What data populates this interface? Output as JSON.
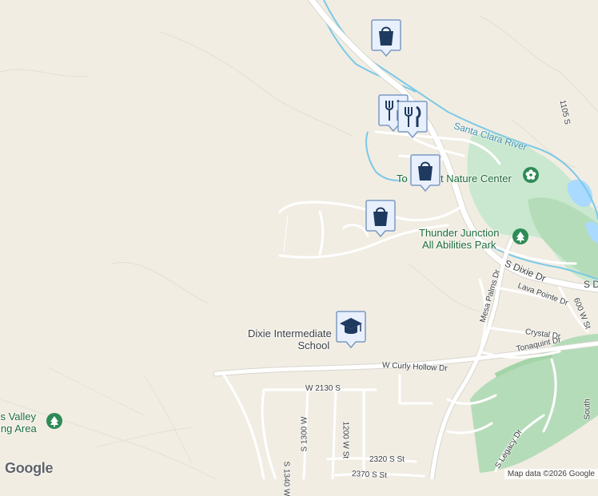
{
  "map": {
    "logo": "Google",
    "attribution": "Map data ©2026 Google"
  },
  "labels": {
    "river": "Santa Clara River",
    "nature_center_part1": "To",
    "nature_center_part2": "at Nature Center",
    "park_line1": "Thunder Junction",
    "park_line2": "All Abilities Park",
    "school_line1": "Dixie Intermediate",
    "school_line2": "School",
    "area_line1": "'s Valley",
    "area_line2": "ing Area"
  },
  "streets": {
    "dixie_dr": "S Dixie Dr",
    "dixie_dr_cut": "S D",
    "mesa_palms": "Mesa Palms Dr",
    "lava_pointe": "Lava Pointe Dr",
    "crystal": "Crystal Dr",
    "tonaquint": "Tonaquint Dr",
    "curly_hollow": "W Curly Hollow Dr",
    "w2130": "W 2130 S",
    "s1300": "S 1300 W",
    "s1340": "S 1340 W",
    "w1200": "1200 W St",
    "s2320": "2320 S St",
    "s2370": "2370 S St",
    "legacy": "S Legacy Dr",
    "s600w": "600 W St",
    "s1105": "1105 S",
    "south": "South"
  },
  "markers": [
    {
      "type": "shopping",
      "icon": "shopping-bag-icon"
    },
    {
      "type": "restaurant",
      "icon": "fork-knife-icon"
    },
    {
      "type": "restaurant",
      "icon": "fork-knife-icon"
    },
    {
      "type": "shopping",
      "icon": "shopping-bag-icon"
    },
    {
      "type": "shopping",
      "icon": "shopping-bag-icon"
    },
    {
      "type": "school",
      "icon": "graduation-cap-icon"
    }
  ],
  "colors": {
    "land": "#f1ede3",
    "road": "#ffffff",
    "road_casing": "#d9d6cf",
    "water": "#aadaff",
    "river_line": "#7cc9e6",
    "park": "#c9e8cf",
    "golf": "#b5dcb8",
    "marker_fill": "#1f3a5f",
    "marker_bg": "#e8f0fe"
  }
}
